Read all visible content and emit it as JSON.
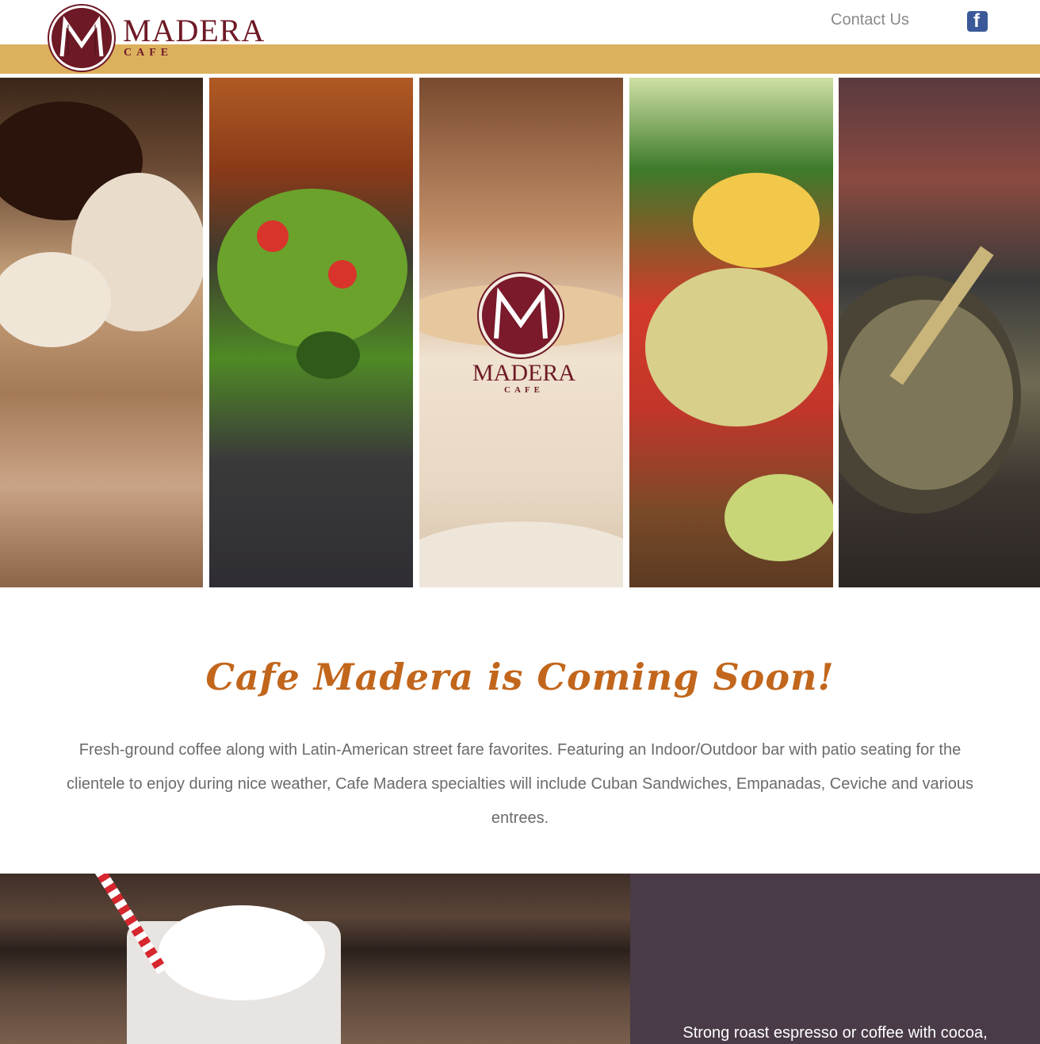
{
  "header": {
    "brand_name": "MADERA",
    "brand_sub": "CAFE",
    "nav": {
      "contact_label": "Contact Us"
    },
    "social": {
      "facebook_icon": "facebook-icon"
    }
  },
  "hero": {
    "panels": [
      "hot-chocolate",
      "guacamole-bowl",
      "latte-cup",
      "chips-and-dip",
      "mate-gourd"
    ],
    "cup_brand_name": "MADERA",
    "cup_brand_sub": "CAFE"
  },
  "intro": {
    "title": "Cafe Madera is Coming Soon!",
    "body": "Fresh-ground coffee along with Latin-American street fare favorites. Featuring an Indoor/Outdoor bar with patio seating for the clientele to enjoy during nice weather, Cafe Madera specialties will include Cuban Sandwiches, Empanadas, Ceviche and various entrees."
  },
  "feature": {
    "text": "Strong roast espresso or coffee with cocoa,"
  },
  "colors": {
    "brand_maroon": "#6e1a26",
    "gold_bar": "#dcb15e",
    "title_orange": "#c2661c",
    "feature_panel": "#4a3b48"
  }
}
